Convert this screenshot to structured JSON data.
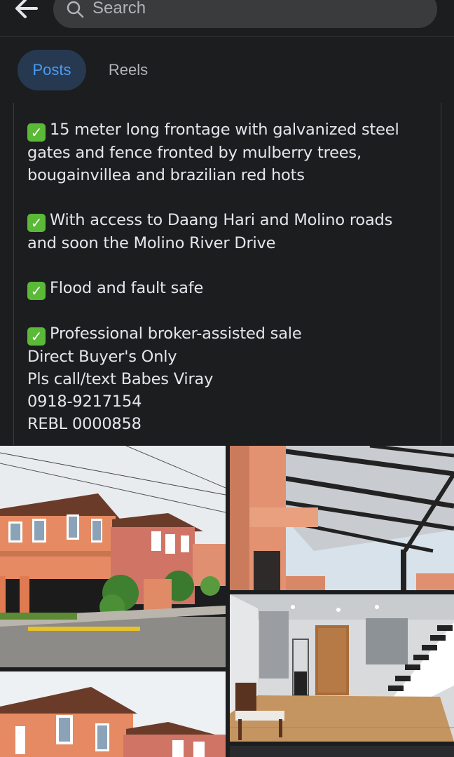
{
  "header": {
    "search_placeholder": "Search",
    "back_icon": "arrow-left-icon",
    "search_icon": "magnifier-icon"
  },
  "tabs": [
    {
      "label": "Posts",
      "active": true
    },
    {
      "label": "Reels",
      "active": false
    }
  ],
  "post": {
    "paragraphs": [
      {
        "check": true,
        "lines": [
          "15 meter long frontage with galvanized steel",
          "gates and fence fronted by mulberry trees,",
          "bougainvillea and brazilian red hots"
        ]
      },
      {
        "check": true,
        "lines": [
          "With access to Daang Hari and Molino roads",
          "and soon the Molino River Drive"
        ]
      },
      {
        "check": true,
        "lines": [
          "Flood and fault safe"
        ]
      },
      {
        "check": true,
        "lines": [
          "Professional broker-assisted sale",
          "Direct Buyer's Only",
          "Pls call/text Babes Viray",
          "0918-9217154",
          "REBL 0000858"
        ]
      }
    ]
  },
  "colors": {
    "background": "#1c1d1f",
    "active_tab_bg": "#263951",
    "active_tab_text": "#4a9cf0",
    "check_green": "#5ab936"
  }
}
